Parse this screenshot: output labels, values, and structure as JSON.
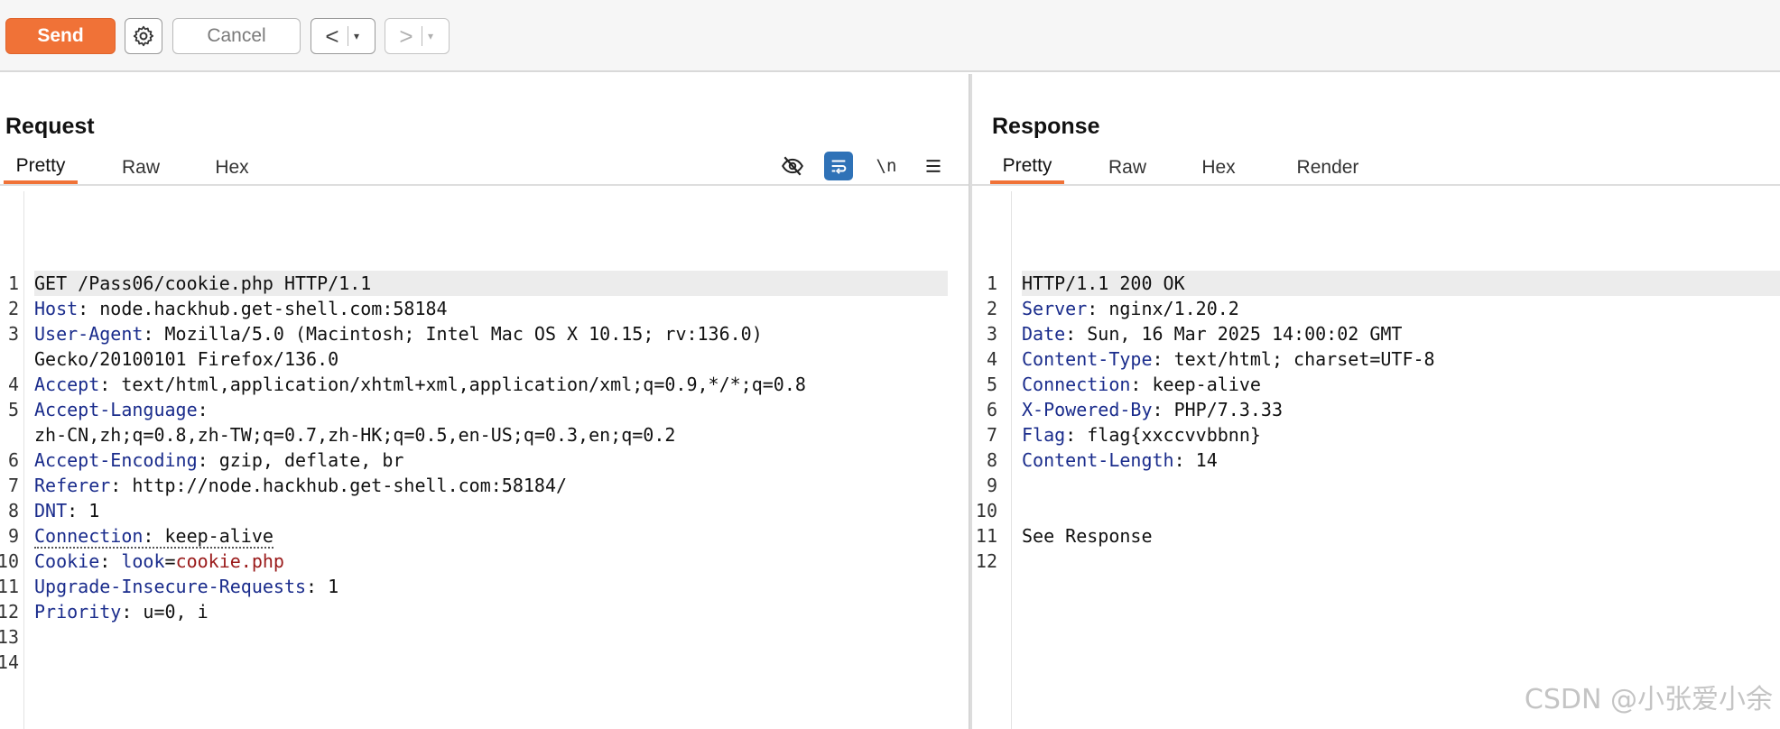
{
  "toolbar": {
    "send_label": "Send",
    "cancel_label": "Cancel",
    "back_arrow": "<",
    "forward_arrow": ">",
    "caret": "▾"
  },
  "request": {
    "title": "Request",
    "tabs": [
      "Pretty",
      "Raw",
      "Hex"
    ],
    "active_tab": "Pretty",
    "newline_toggle": "\\n",
    "line_numbers": [
      "1",
      "2",
      "3",
      "",
      "4",
      "5",
      "",
      "6",
      "7",
      "8",
      "9",
      "10",
      "11",
      "12",
      "13",
      "14"
    ],
    "lines": {
      "l1": "GET /Pass06/cookie.php HTTP/1.1",
      "l2k": "Host",
      "l2v": " node.hackhub.get-shell.com:58184",
      "l3k": "User-Agent",
      "l3v": " Mozilla/5.0 (Macintosh; Intel Mac OS X 10.15; rv:136.0)",
      "l3c": "Gecko/20100101 Firefox/136.0",
      "l4k": "Accept",
      "l4v": " text/html,application/xhtml+xml,application/xml;q=0.9,*/*;q=0.8",
      "l5k": "Accept-Language",
      "l5v": "",
      "l5c": "zh-CN,zh;q=0.8,zh-TW;q=0.7,zh-HK;q=0.5,en-US;q=0.3,en;q=0.2",
      "l6k": "Accept-Encoding",
      "l6v": " gzip, deflate, br",
      "l7k": "Referer",
      "l7v": " http://node.hackhub.get-shell.com:58184/",
      "l8k": "DNT",
      "l8v": " 1",
      "l9k": "Connection",
      "l9v": " keep-alive",
      "l10k": "Cookie",
      "l10sep": ": ",
      "l10name": "look",
      "l10eq": "=",
      "l10val": "cookie.php",
      "l11k": "Upgrade-Insecure-Requests",
      "l11v": " 1",
      "l12k": "Priority",
      "l12v": " u=0, i"
    }
  },
  "response": {
    "title": "Response",
    "tabs": [
      "Pretty",
      "Raw",
      "Hex",
      "Render"
    ],
    "active_tab": "Pretty",
    "line_numbers": [
      "1",
      "2",
      "3",
      "4",
      "5",
      "6",
      "7",
      "8",
      "9",
      "10",
      "11",
      "12"
    ],
    "lines": {
      "l1": "HTTP/1.1 200 OK",
      "l2k": "Server",
      "l2v": " nginx/1.20.2",
      "l3k": "Date",
      "l3v": " Sun, 16 Mar 2025 14:00:02 GMT",
      "l4k": "Content-Type",
      "l4v": " text/html; charset=UTF-8",
      "l5k": "Connection",
      "l5v": " keep-alive",
      "l6k": "X-Powered-By",
      "l6v": " PHP/7.3.33",
      "l7k": "Flag",
      "l7v": " flag{xxccvvbbnn}",
      "l8k": "Content-Length",
      "l8v": " 14",
      "l11": "See Response"
    }
  },
  "watermark": "CSDN @小张爱小余"
}
